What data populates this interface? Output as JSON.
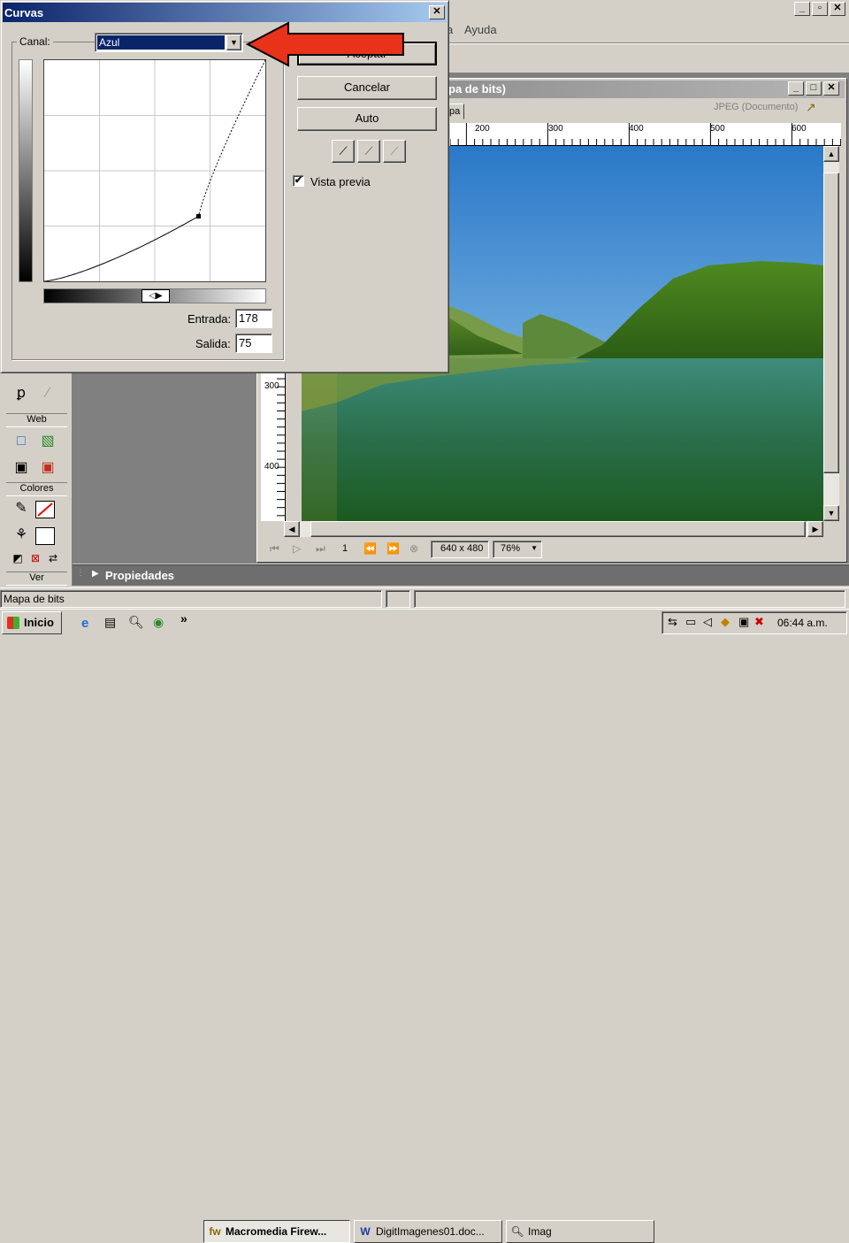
{
  "main_app": {
    "menu": {
      "help": "Ayuda",
      "partial": "a"
    },
    "doc_window": {
      "title": "pa de bits)",
      "tab": "pa",
      "format": "JPEG (Documento)"
    },
    "ruler_top": [
      "200",
      "300",
      "400",
      "500",
      "600"
    ],
    "ruler_left": [
      "300",
      "400"
    ],
    "status": {
      "frame": "1",
      "size": "640 x 480",
      "zoom": "76%"
    },
    "tools": {
      "web": "Web",
      "colors": "Colores",
      "view": "Ver"
    },
    "properties": "Propiedades",
    "statusbar": "Mapa de bits"
  },
  "dialog": {
    "title": "Curvas",
    "channel_label": "Canal:",
    "channel_value": "Azul",
    "ok_label": "Aceptar",
    "cancel_label": "Cancelar",
    "auto_label": "Auto",
    "preview_label": "Vista previa",
    "preview_checked": true,
    "input_label": "Entrada:",
    "input_value": "178",
    "output_label": "Salida:",
    "output_value": "75",
    "curve_point": {
      "input": 178,
      "output": 75
    }
  },
  "taskbar": {
    "start": "Inicio",
    "tasks": [
      {
        "label": "Macromedia Firew...",
        "active": true
      },
      {
        "label": "DigitImagenes01.doc...",
        "active": false
      },
      {
        "label": "Imag",
        "active": false
      }
    ],
    "chevron": "»",
    "clock": "06:44 a.m."
  },
  "colors": {
    "accent": "#0a246a",
    "arrow": "#e8321a",
    "titlebar": "#0a246a"
  },
  "icons": [
    "eyedropper-icon",
    "checkbox-icon",
    "close-icon",
    "minimize-icon",
    "maximize-icon",
    "arrow-icon"
  ]
}
